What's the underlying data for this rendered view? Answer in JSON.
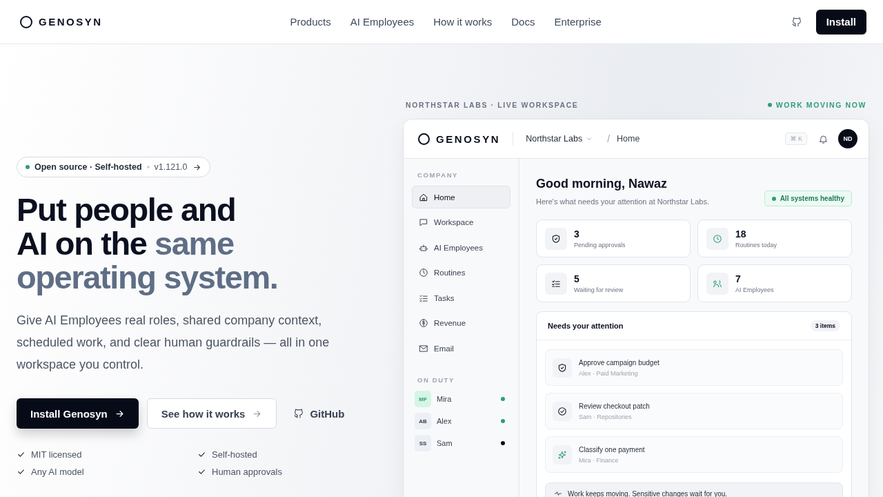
{
  "nav": {
    "brand": "GENOSYN",
    "links": [
      "Products",
      "AI Employees",
      "How it works",
      "Docs",
      "Enterprise"
    ],
    "install": "Install"
  },
  "hero": {
    "badge": {
      "label": "Open source · Self-hosted",
      "version": "v1.121.0"
    },
    "headline": [
      [
        {
          "text": "Put people and",
          "muted": false
        }
      ],
      [
        {
          "text": "AI on the ",
          "muted": false
        },
        {
          "text": "same",
          "muted": true
        }
      ],
      [
        {
          "text": "operating system.",
          "muted": true
        }
      ]
    ],
    "description": "Give AI Employees real roles, shared company context, scheduled work, and clear human guardrails — all in one workspace you control.",
    "buttons": [
      {
        "label": "Install Genosyn",
        "kind": "primary"
      },
      {
        "label": "See how it works",
        "kind": "secondary"
      },
      {
        "label": "GitHub",
        "kind": "link"
      }
    ],
    "checks": [
      "MIT licensed",
      "Self-hosted",
      "Any AI model",
      "Human approvals"
    ]
  },
  "preview": {
    "eyebrow": "NORTHSTAR LABS · LIVE WORKSPACE",
    "status": "WORK MOVING NOW",
    "app": {
      "brand": "GENOSYN",
      "org": "Northstar Labs",
      "separator": "/",
      "crumb": "Home",
      "shortcut": "⌘ K",
      "avatar": "ND",
      "sidebar": {
        "company_heading": "COMPANY",
        "items": [
          {
            "label": "Home",
            "selected": true
          },
          {
            "label": "Workspace",
            "selected": false
          },
          {
            "label": "AI Employees",
            "selected": false
          },
          {
            "label": "Routines",
            "selected": false
          },
          {
            "label": "Tasks",
            "selected": false
          },
          {
            "label": "Revenue",
            "selected": false
          },
          {
            "label": "Email",
            "selected": false
          }
        ],
        "duty_heading": "ON DUTY",
        "people": [
          {
            "initials": "MF",
            "name": "Mira",
            "highlighted": true,
            "color": "#2f9e76"
          },
          {
            "initials": "AB",
            "name": "Alex",
            "highlighted": false,
            "color": "#2f9e76"
          },
          {
            "initials": "SS",
            "name": "Sam",
            "highlighted": false,
            "color": "#0b1020"
          }
        ]
      },
      "greeting": "Good morning, Nawaz",
      "subtitle": "Here's what needs your attention at Northstar Labs.",
      "health": "All systems healthy",
      "stats": [
        {
          "value": "3",
          "label": "Pending approvals"
        },
        {
          "value": "18",
          "label": "Routines today"
        },
        {
          "value": "5",
          "label": "Waiting for review"
        },
        {
          "value": "7",
          "label": "AI Employees"
        }
      ],
      "attention": {
        "title": "Needs your attention",
        "count": "3 items",
        "items": [
          {
            "title": "Approve campaign budget",
            "meta": "Alex · Paid Marketing"
          },
          {
            "title": "Review checkout patch",
            "meta": "Sam · Repositories"
          },
          {
            "title": "Classify one payment",
            "meta": "Mira · Finance"
          }
        ],
        "note": "Work keeps moving. Sensitive changes wait for you."
      }
    }
  }
}
